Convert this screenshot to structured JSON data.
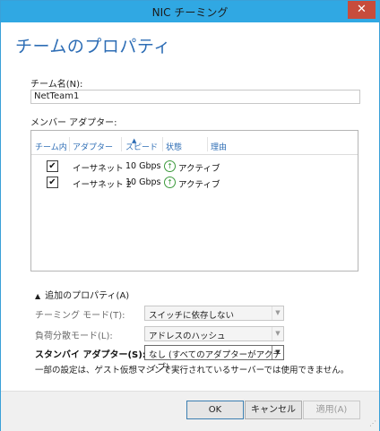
{
  "window": {
    "title": "NIC チーミング",
    "close_glyph": "✕"
  },
  "page": {
    "heading": "チームのプロパティ"
  },
  "team_name": {
    "label": "チーム名(N):",
    "value": "NetTeam1"
  },
  "members": {
    "label": "メンバー アダプター:",
    "columns": [
      "チーム内",
      "アダプター",
      "スピード",
      "状態",
      "理由"
    ],
    "rows": [
      {
        "checked": true,
        "adapter": "イーサネット",
        "speed": "10 Gbps",
        "status": "アクティブ",
        "reason": ""
      },
      {
        "checked": true,
        "adapter": "イーサネット 2",
        "speed": "10 Gbps",
        "status": "アクティブ",
        "reason": ""
      }
    ]
  },
  "additional": {
    "toggle": "追加のプロパティ(A)",
    "teaming_mode": {
      "label": "チーミング モード(T):",
      "value": "スイッチに依存しない"
    },
    "load_balancing": {
      "label": "負荷分散モード(L):",
      "value": "アドレスのハッシュ"
    },
    "standby": {
      "label": "スタンバイ アダプター(S):",
      "value": "なし (すべてのアダプターがアクティブ)"
    },
    "note": "一部の設定は、ゲスト仮想マシンで実行されているサーバーでは使用できません。"
  },
  "buttons": {
    "ok": "OK",
    "cancel": "キャンセル",
    "apply": "適用(A)"
  },
  "colors": {
    "titlebar": "#30a8e3",
    "accent": "#2d6db5",
    "close": "#c74c3c",
    "status_ok": "#3c9a3c"
  }
}
